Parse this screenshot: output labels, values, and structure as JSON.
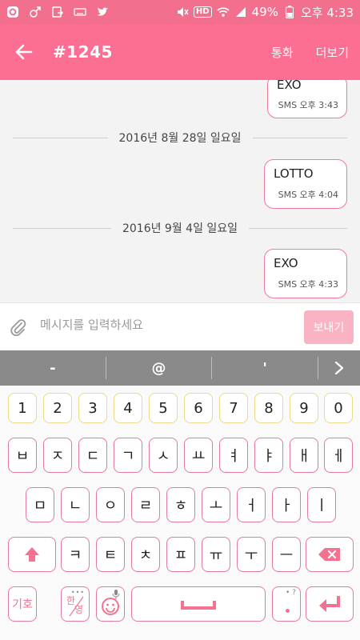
{
  "status_bar": {
    "battery": "49%",
    "time": "오후 4:33",
    "hd_label": "HD",
    "icons": [
      "app-o-icon",
      "male-icon",
      "screen-icon",
      "keyboard-icon",
      "twitter-icon",
      "mute-icon",
      "wifi-icon",
      "signal-icon",
      "battery-icon"
    ]
  },
  "app_bar": {
    "title": "#1245",
    "call_label": "통화",
    "more_label": "더보기"
  },
  "messages": [
    {
      "type": "bubble",
      "text": "EXO",
      "meta": "SMS 오후 3:43"
    },
    {
      "type": "date",
      "text": "2016년 8월 28일 일요일"
    },
    {
      "type": "bubble",
      "text": "LOTTO",
      "meta": "SMS 오후 4:04"
    },
    {
      "type": "date",
      "text": "2016년 9월 4일 일요일"
    },
    {
      "type": "bubble",
      "text": "EXO",
      "meta": "SMS 오후 4:33"
    }
  ],
  "input": {
    "placeholder": "메시지를 입력하세요",
    "send_label": "보내기"
  },
  "suggestions": [
    "-",
    "@",
    "'"
  ],
  "keyboard": {
    "row_numbers": [
      "1",
      "2",
      "3",
      "4",
      "5",
      "6",
      "7",
      "8",
      "9",
      "0"
    ],
    "row1": [
      "ㅂ",
      "ㅈ",
      "ㄷ",
      "ㄱ",
      "ㅅ",
      "ㅛ",
      "ㅕ",
      "ㅑ",
      "ㅐ",
      "ㅔ"
    ],
    "row2": [
      "ㅁ",
      "ㄴ",
      "ㅇ",
      "ㄹ",
      "ㅎ",
      "ㅗ",
      "ㅓ",
      "ㅏ",
      "ㅣ"
    ],
    "row3": [
      "ㅋ",
      "ㅌ",
      "ㅊ",
      "ㅍ",
      "ㅠ",
      "ㅜ",
      "ㅡ"
    ],
    "symbols_label": "기호",
    "lang_top": "한",
    "lang_bottom": "영"
  },
  "colors": {
    "accent": "#fc6e92",
    "status": "#f2708e",
    "bubble_border": "#f07a98",
    "send_bg": "#f9b3c3"
  }
}
